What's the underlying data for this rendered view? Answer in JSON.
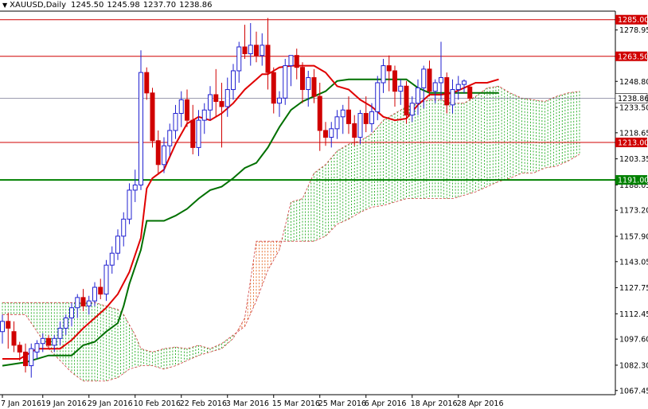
{
  "header": {
    "symbol": "XAUUSD,Daily",
    "ohlc": [
      "1245.50",
      "1245.98",
      "1237.70",
      "1238.86"
    ]
  },
  "colors": {
    "bull": "#2020d0",
    "bear": "#d00000",
    "tenkan": "#e00000",
    "kijun": "#007000",
    "kumo_bull": "#00a000",
    "kumo_bear": "#e05000",
    "resistance": "#d00000",
    "support": "#008000",
    "price_line": "#606080"
  },
  "chart_data": {
    "type": "candlestick",
    "title": "XAUUSD,Daily",
    "ylim": [
      1065,
      1290
    ],
    "y_ticks": [
      "1278.95",
      "1263.50",
      "1248.80",
      "1233.50",
      "1218.65",
      "1203.35",
      "1188.05",
      "1173.20",
      "1157.90",
      "1143.05",
      "1127.75",
      "1112.45",
      "1097.60",
      "1082.30",
      "1067.45"
    ],
    "x_ticks": [
      {
        "label": "7 Jan 2016",
        "i": 0
      },
      {
        "label": "19 Jan 2016",
        "i": 7
      },
      {
        "label": "29 Jan 2016",
        "i": 15
      },
      {
        "label": "10 Feb 2016",
        "i": 23
      },
      {
        "label": "22 Feb 2016",
        "i": 31
      },
      {
        "label": "3 Mar 2016",
        "i": 39
      },
      {
        "label": "15 Mar 2016",
        "i": 47
      },
      {
        "label": "25 Mar 2016",
        "i": 55
      },
      {
        "label": "6 Apr 2016",
        "i": 63
      },
      {
        "label": "18 Apr 2016",
        "i": 71
      },
      {
        "label": "28 Apr 2016",
        "i": 79
      }
    ],
    "horizontal_levels": [
      {
        "label": "1285.00",
        "value": 1285.0,
        "kind": "resistance"
      },
      {
        "label": "1263.50",
        "value": 1263.5,
        "kind": "resistance"
      },
      {
        "label": "1213.00",
        "value": 1213.0,
        "kind": "resistance"
      },
      {
        "label": "1191.00",
        "value": 1191.0,
        "kind": "support"
      }
    ],
    "current_price": {
      "label": "1238.86",
      "value": 1238.86
    },
    "candles": [
      [
        1102,
        1112,
        1095,
        1108
      ],
      [
        1108,
        1113,
        1092,
        1104
      ],
      [
        1102,
        1108,
        1090,
        1094
      ],
      [
        1094,
        1096,
        1085,
        1090
      ],
      [
        1090,
        1095,
        1078,
        1082
      ],
      [
        1082,
        1095,
        1075,
        1092
      ],
      [
        1090,
        1097,
        1086,
        1095
      ],
      [
        1095,
        1101,
        1090,
        1098
      ],
      [
        1098,
        1100,
        1092,
        1094
      ],
      [
        1094,
        1100,
        1090,
        1098
      ],
      [
        1098,
        1108,
        1094,
        1104
      ],
      [
        1104,
        1112,
        1100,
        1110
      ],
      [
        1110,
        1119,
        1105,
        1116
      ],
      [
        1116,
        1124,
        1110,
        1122
      ],
      [
        1122,
        1127,
        1114,
        1117
      ],
      [
        1117,
        1123,
        1112,
        1120
      ],
      [
        1120,
        1131,
        1117,
        1128
      ],
      [
        1128,
        1133,
        1121,
        1124
      ],
      [
        1124,
        1144,
        1120,
        1141
      ],
      [
        1141,
        1152,
        1136,
        1148
      ],
      [
        1148,
        1162,
        1144,
        1158
      ],
      [
        1158,
        1172,
        1152,
        1168
      ],
      [
        1168,
        1189,
        1165,
        1185
      ],
      [
        1185,
        1197,
        1178,
        1188
      ],
      [
        1188,
        1267,
        1185,
        1254
      ],
      [
        1254,
        1257,
        1238,
        1242
      ],
      [
        1242,
        1245,
        1210,
        1214
      ],
      [
        1214,
        1220,
        1194,
        1200
      ],
      [
        1200,
        1216,
        1195,
        1211
      ],
      [
        1211,
        1224,
        1205,
        1220
      ],
      [
        1220,
        1235,
        1215,
        1230
      ],
      [
        1230,
        1243,
        1222,
        1238
      ],
      [
        1238,
        1244,
        1222,
        1226
      ],
      [
        1226,
        1235,
        1206,
        1210
      ],
      [
        1210,
        1232,
        1205,
        1226
      ],
      [
        1226,
        1236,
        1218,
        1232
      ],
      [
        1232,
        1246,
        1226,
        1241
      ],
      [
        1241,
        1256,
        1228,
        1237
      ],
      [
        1237,
        1248,
        1210,
        1234
      ],
      [
        1234,
        1251,
        1228,
        1244
      ],
      [
        1244,
        1259,
        1238,
        1255
      ],
      [
        1255,
        1272,
        1248,
        1269
      ],
      [
        1269,
        1282,
        1262,
        1265
      ],
      [
        1265,
        1283,
        1258,
        1270
      ],
      [
        1270,
        1278,
        1260,
        1264
      ],
      [
        1264,
        1277,
        1258,
        1270
      ],
      [
        1270,
        1286,
        1244,
        1254
      ],
      [
        1254,
        1257,
        1230,
        1236
      ],
      [
        1236,
        1243,
        1228,
        1239
      ],
      [
        1239,
        1262,
        1235,
        1258
      ],
      [
        1258,
        1264,
        1246,
        1264
      ],
      [
        1264,
        1268,
        1250,
        1257
      ],
      [
        1257,
        1260,
        1236,
        1244
      ],
      [
        1244,
        1255,
        1234,
        1251
      ],
      [
        1251,
        1256,
        1236,
        1240
      ],
      [
        1240,
        1248,
        1208,
        1220
      ],
      [
        1220,
        1225,
        1211,
        1216
      ],
      [
        1216,
        1225,
        1210,
        1221
      ],
      [
        1221,
        1232,
        1215,
        1228
      ],
      [
        1228,
        1235,
        1218,
        1232
      ],
      [
        1232,
        1240,
        1218,
        1224
      ],
      [
        1224,
        1229,
        1211,
        1216
      ],
      [
        1216,
        1232,
        1212,
        1230
      ],
      [
        1230,
        1240,
        1219,
        1224
      ],
      [
        1224,
        1236,
        1219,
        1231
      ],
      [
        1231,
        1252,
        1226,
        1248
      ],
      [
        1248,
        1262,
        1242,
        1258
      ],
      [
        1258,
        1264,
        1243,
        1255
      ],
      [
        1255,
        1258,
        1234,
        1243
      ],
      [
        1243,
        1250,
        1235,
        1246
      ],
      [
        1246,
        1249,
        1224,
        1229
      ],
      [
        1229,
        1240,
        1225,
        1236
      ],
      [
        1236,
        1250,
        1229,
        1245
      ],
      [
        1245,
        1258,
        1233,
        1256
      ],
      [
        1256,
        1261,
        1240,
        1243
      ],
      [
        1243,
        1250,
        1236,
        1248
      ],
      [
        1248,
        1272,
        1238,
        1251
      ],
      [
        1251,
        1254,
        1230,
        1235
      ],
      [
        1235,
        1250,
        1230,
        1244
      ],
      [
        1244,
        1252,
        1238,
        1247
      ],
      [
        1247,
        1250,
        1242,
        1249
      ],
      [
        1245.5,
        1245.98,
        1237.7,
        1238.86
      ]
    ],
    "tenkan_sen": [
      [
        0,
        1086
      ],
      [
        3,
        1086
      ],
      [
        6,
        1092
      ],
      [
        8,
        1092
      ],
      [
        10,
        1092
      ],
      [
        12,
        1097
      ],
      [
        14,
        1104
      ],
      [
        16,
        1110
      ],
      [
        18,
        1116
      ],
      [
        20,
        1124
      ],
      [
        22,
        1137
      ],
      [
        24,
        1157
      ],
      [
        25,
        1186
      ],
      [
        26,
        1192
      ],
      [
        28,
        1197
      ],
      [
        30,
        1212
      ],
      [
        32,
        1224
      ],
      [
        34,
        1228
      ],
      [
        36,
        1226
      ],
      [
        38,
        1230
      ],
      [
        40,
        1236
      ],
      [
        42,
        1244
      ],
      [
        44,
        1250
      ],
      [
        45,
        1253
      ],
      [
        46,
        1253
      ],
      [
        48,
        1257
      ],
      [
        50,
        1258
      ],
      [
        52,
        1258
      ],
      [
        54,
        1258
      ],
      [
        56,
        1254
      ],
      [
        58,
        1246
      ],
      [
        60,
        1244
      ],
      [
        62,
        1238
      ],
      [
        64,
        1234
      ],
      [
        66,
        1228
      ],
      [
        68,
        1226
      ],
      [
        70,
        1227
      ],
      [
        72,
        1235
      ],
      [
        74,
        1241
      ],
      [
        76,
        1241
      ],
      [
        78,
        1242
      ],
      [
        80,
        1245
      ],
      [
        82,
        1248
      ],
      [
        84,
        1248
      ],
      [
        86,
        1250
      ]
    ],
    "kijun_sen": [
      [
        0,
        1082
      ],
      [
        4,
        1084
      ],
      [
        8,
        1088
      ],
      [
        12,
        1088
      ],
      [
        14,
        1094
      ],
      [
        16,
        1096
      ],
      [
        18,
        1102
      ],
      [
        20,
        1107
      ],
      [
        21,
        1117
      ],
      [
        22,
        1130
      ],
      [
        24,
        1150
      ],
      [
        25,
        1167
      ],
      [
        28,
        1167
      ],
      [
        30,
        1170
      ],
      [
        32,
        1174
      ],
      [
        34,
        1180
      ],
      [
        36,
        1185
      ],
      [
        38,
        1187
      ],
      [
        40,
        1192
      ],
      [
        42,
        1198
      ],
      [
        44,
        1201
      ],
      [
        46,
        1210
      ],
      [
        48,
        1222
      ],
      [
        50,
        1232
      ],
      [
        52,
        1237
      ],
      [
        54,
        1240
      ],
      [
        56,
        1243
      ],
      [
        58,
        1249
      ],
      [
        60,
        1250
      ],
      [
        62,
        1250
      ],
      [
        64,
        1250
      ],
      [
        66,
        1250
      ],
      [
        68,
        1250
      ],
      [
        70,
        1250
      ],
      [
        72,
        1245
      ],
      [
        74,
        1242
      ],
      [
        76,
        1242
      ],
      [
        78,
        1242
      ],
      [
        80,
        1242
      ],
      [
        82,
        1242
      ],
      [
        84,
        1242
      ],
      [
        86,
        1242
      ]
    ],
    "senkou_span_a": [
      [
        0,
        1119
      ],
      [
        4,
        1119
      ],
      [
        8,
        1119
      ],
      [
        12,
        1119
      ],
      [
        14,
        1119
      ],
      [
        16,
        1119
      ],
      [
        18,
        1117
      ],
      [
        20,
        1115
      ],
      [
        21,
        1112
      ],
      [
        23,
        1100
      ],
      [
        24,
        1092
      ],
      [
        26,
        1090
      ],
      [
        28,
        1092
      ],
      [
        30,
        1093
      ],
      [
        32,
        1092
      ],
      [
        34,
        1094
      ],
      [
        36,
        1092
      ],
      [
        38,
        1095
      ],
      [
        40,
        1100
      ],
      [
        42,
        1105
      ],
      [
        44,
        1120
      ],
      [
        46,
        1138
      ],
      [
        48,
        1150
      ],
      [
        50,
        1178
      ],
      [
        52,
        1180
      ],
      [
        54,
        1195
      ],
      [
        56,
        1200
      ],
      [
        58,
        1208
      ],
      [
        60,
        1212
      ],
      [
        62,
        1214
      ],
      [
        64,
        1218
      ],
      [
        66,
        1226
      ],
      [
        68,
        1230
      ],
      [
        70,
        1234
      ],
      [
        72,
        1236
      ],
      [
        74,
        1238
      ],
      [
        76,
        1238
      ],
      [
        78,
        1236
      ],
      [
        80,
        1236
      ],
      [
        82,
        1240
      ],
      [
        84,
        1245
      ],
      [
        86,
        1246
      ],
      [
        88,
        1242
      ],
      [
        90,
        1239
      ],
      [
        92,
        1238
      ],
      [
        94,
        1237
      ],
      [
        96,
        1240
      ],
      [
        98,
        1242
      ],
      [
        100,
        1243
      ]
    ],
    "senkou_span_b": [
      [
        0,
        1112
      ],
      [
        4,
        1112
      ],
      [
        8,
        1092
      ],
      [
        12,
        1078
      ],
      [
        14,
        1073
      ],
      [
        16,
        1073
      ],
      [
        18,
        1073
      ],
      [
        20,
        1075
      ],
      [
        22,
        1080
      ],
      [
        24,
        1082
      ],
      [
        26,
        1082
      ],
      [
        28,
        1080
      ],
      [
        30,
        1082
      ],
      [
        32,
        1085
      ],
      [
        34,
        1088
      ],
      [
        36,
        1090
      ],
      [
        38,
        1092
      ],
      [
        40,
        1098
      ],
      [
        42,
        1110
      ],
      [
        44,
        1155
      ],
      [
        46,
        1155
      ],
      [
        48,
        1155
      ],
      [
        50,
        1155
      ],
      [
        52,
        1155
      ],
      [
        54,
        1155
      ],
      [
        56,
        1158
      ],
      [
        58,
        1165
      ],
      [
        60,
        1168
      ],
      [
        62,
        1172
      ],
      [
        64,
        1175
      ],
      [
        66,
        1176
      ],
      [
        68,
        1178
      ],
      [
        70,
        1180
      ],
      [
        72,
        1180
      ],
      [
        74,
        1180
      ],
      [
        76,
        1180
      ],
      [
        78,
        1180
      ],
      [
        80,
        1182
      ],
      [
        82,
        1184
      ],
      [
        84,
        1187
      ],
      [
        86,
        1190
      ],
      [
        88,
        1192
      ],
      [
        90,
        1195
      ],
      [
        92,
        1195
      ],
      [
        94,
        1198
      ],
      [
        96,
        1199
      ],
      [
        98,
        1202
      ],
      [
        100,
        1206
      ]
    ],
    "kumo_fill_color_rule": "green where span A above span B, orange where below"
  }
}
